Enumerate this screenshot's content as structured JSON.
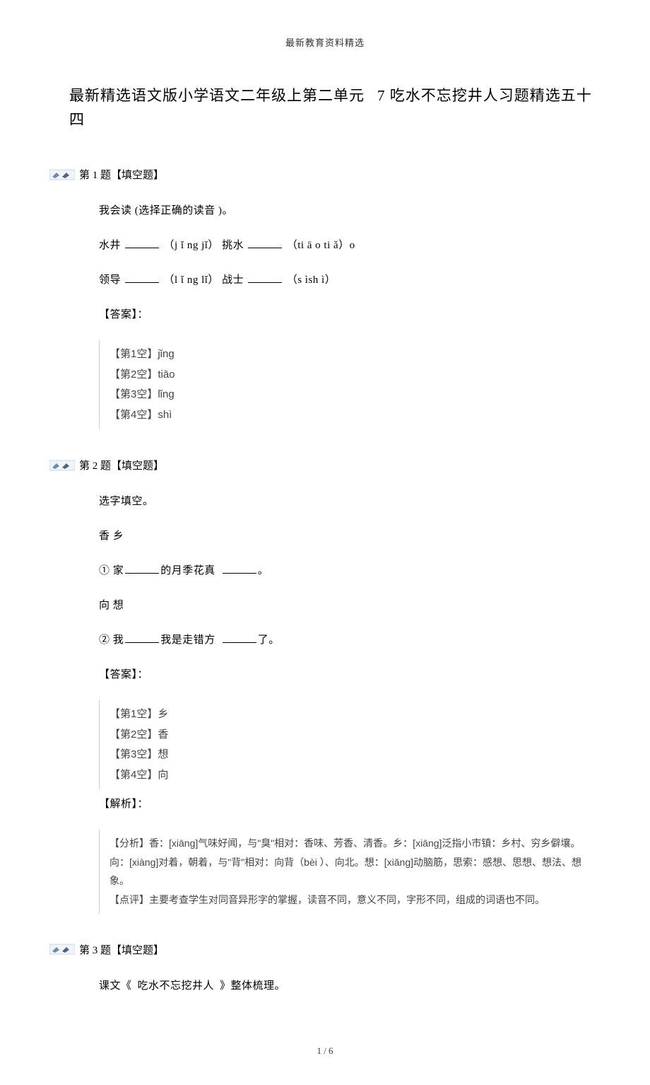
{
  "header": "最新教育资料精选",
  "title_part1": "最新精选语文版小学语文二年级上第二单元",
  "title_part2": "7 吃水不忘挖井人习题精选五十四",
  "questions": [
    {
      "head": "第 1 题【填空题】",
      "prompt": "我会读 (选择正确的读音   )。",
      "line1_a": "水井",
      "line1_b": "（j ǐ  ng jǐ） 挑水",
      "line1_c": "（ti ā o ti ǎ）o",
      "line2_a": "领导",
      "line2_b": "（l ǐ  ng lǐ） 战士",
      "line2_c": "（s ìsh ì）",
      "ans_label": "【答案】：",
      "answers": [
        "【第1空】jǐng",
        "【第2空】tiāo",
        "【第3空】lǐng",
        "【第4空】shì"
      ]
    },
    {
      "head": "第 2 题【填空题】",
      "prompt": "选字填空。",
      "pair1": "香  乡",
      "line1_a": "① 家",
      "line1_b": "的月季花真",
      "line1_c": "。",
      "pair2": "向  想",
      "line2_a": "② 我",
      "line2_b": "我是走错方",
      "line2_c": "了。",
      "ans_label": "【答案】：",
      "answers": [
        "【第1空】乡",
        "【第2空】香",
        "【第3空】想",
        "【第4空】向"
      ],
      "analysis_label": "【解析】：",
      "analysis_line1": "【分析】香：[xiāng]气味好闻，与\"臭\"相对：香味、芳香、清香。乡：[xiāng]泛指小市镇：乡村、穷乡僻壤。向：[xiàng]对着，朝着，与\"背\"相对：向背（bèi  ）、向北。想：[xiǎng]动脑筋，思索：感想、思想、想法、想象。",
      "analysis_line2": "【点评】主要考查学生对同音异形字的掌握，读音不同，意义不同，字形不同，组成的词语也不同。"
    },
    {
      "head": "第 3 题【填空题】",
      "prompt_a": "课文《",
      "prompt_b": "吃水不忘挖井人",
      "prompt_c": "》整体梳理。"
    }
  ],
  "footer": "1  /  6"
}
